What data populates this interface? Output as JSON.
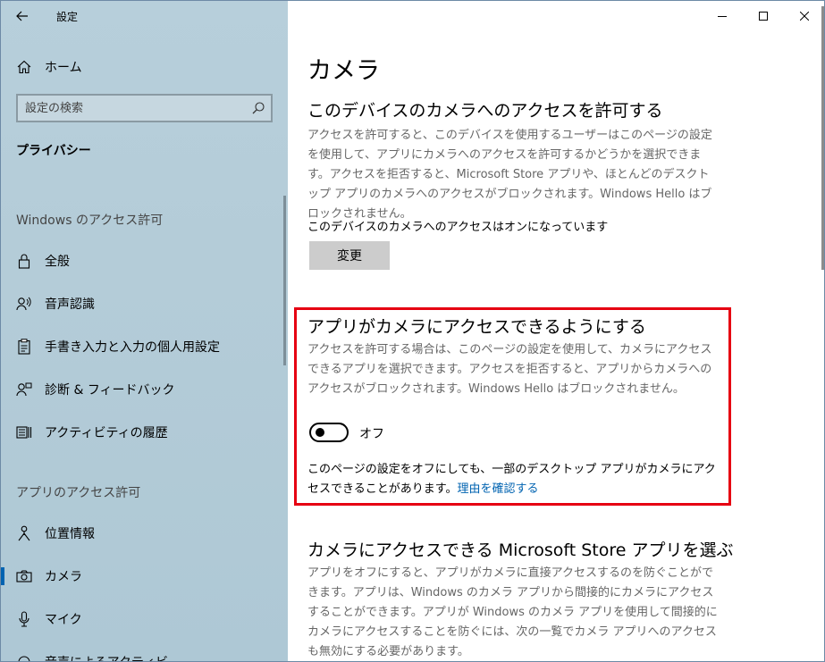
{
  "app": {
    "title": "設定",
    "back_icon": "back-arrow-icon"
  },
  "caption_buttons": {
    "minimize": "minimize-icon",
    "maximize": "maximize-icon",
    "close": "close-icon"
  },
  "sidebar": {
    "home_label": "ホーム",
    "search_placeholder": "設定の検索",
    "category_title": "プライバシー",
    "windows_section": "Windows のアクセス許可",
    "windows_items": [
      {
        "label": "全般",
        "icon": "lock-icon"
      },
      {
        "label": "音声認識",
        "icon": "speech-person-icon"
      },
      {
        "label": "手書き入力と入力の個人用設定",
        "icon": "clipboard-icon"
      },
      {
        "label": "診断 & フィードバック",
        "icon": "feedback-person-icon"
      },
      {
        "label": "アクティビティの履歴",
        "icon": "activity-history-icon"
      }
    ],
    "app_section": "アプリのアクセス許可",
    "app_items": [
      {
        "label": "位置情報",
        "icon": "location-person-icon"
      },
      {
        "label": "カメラ",
        "icon": "camera-icon",
        "active": true
      },
      {
        "label": "マイク",
        "icon": "microphone-icon"
      },
      {
        "label": "音声によるアクティビ",
        "icon": "voice-activation-icon"
      }
    ]
  },
  "main": {
    "page_title": "カメラ",
    "device_access": {
      "heading": "このデバイスのカメラへのアクセスを許可する",
      "description": "アクセスを許可すると、このデバイスを使用するユーザーはこのページの設定を使用して、アプリにカメラへのアクセスを許可するかどうかを選択できます。アクセスを拒否すると、Microsoft Store アプリや、ほとんどのデスクトップ アプリのカメラへのアクセスがブロックされます。Windows Hello はブロックされません。",
      "status": "このデバイスのカメラへのアクセスはオンになっています",
      "change_button": "変更"
    },
    "app_access": {
      "heading": "アプリがカメラにアクセスできるようにする",
      "description": "アクセスを許可する場合は、このページの設定を使用して、カメラにアクセスできるアプリを選択できます。アクセスを拒否すると、アプリからカメラへのアクセスがブロックされます。Windows Hello はブロックされません。",
      "toggle_state": "オフ",
      "note": "このページの設定をオフにしても、一部のデスクトップ アプリがカメラにアクセスできることがあります。",
      "link": "理由を確認する",
      "highlight_color": "#e60012"
    },
    "store_apps": {
      "heading": "カメラにアクセスできる Microsoft Store アプリを選ぶ",
      "description": "アプリをオフにすると、アプリがカメラに直接アクセスするのを防ぐことができます。アプリは、Windows のカメラ アプリから間接的にカメラにアクセスすることができます。アプリが Windows のカメラ アプリを使用して間接的にカメラにアクセスすることを防ぐには、次の一覧でカメラ アプリへのアクセスも無効にする必要があります。"
    }
  },
  "colors": {
    "accent": "#0063b1",
    "sidebar_bg": "#b4ccd8"
  }
}
